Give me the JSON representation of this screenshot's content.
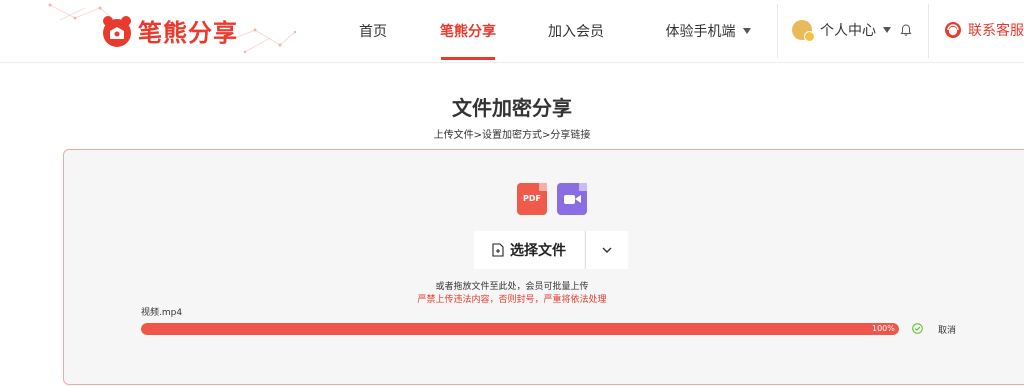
{
  "header": {
    "logo_text": "笔熊分享",
    "nav": [
      {
        "label": "首页"
      },
      {
        "label": "笔熊分享",
        "active": true
      },
      {
        "label": "加入会员"
      },
      {
        "label": "体验手机端"
      }
    ],
    "user_center": "个人中心",
    "customer_service": "联系客服",
    "brand_color": "#e83b2e"
  },
  "page": {
    "title": "文件加密分享",
    "steps": "上传文件>设置加密方式>分享链接"
  },
  "upload": {
    "pdf_label": "PDF",
    "select_label": "选择文件",
    "hint": "或者拖放文件至此处，会员可批量上传",
    "warning": "严禁上传违法内容，否则封号，严重将依法处理",
    "file_name": "视频.mp4",
    "progress": 100,
    "progress_text": "100%",
    "cancel_label": "取消"
  }
}
